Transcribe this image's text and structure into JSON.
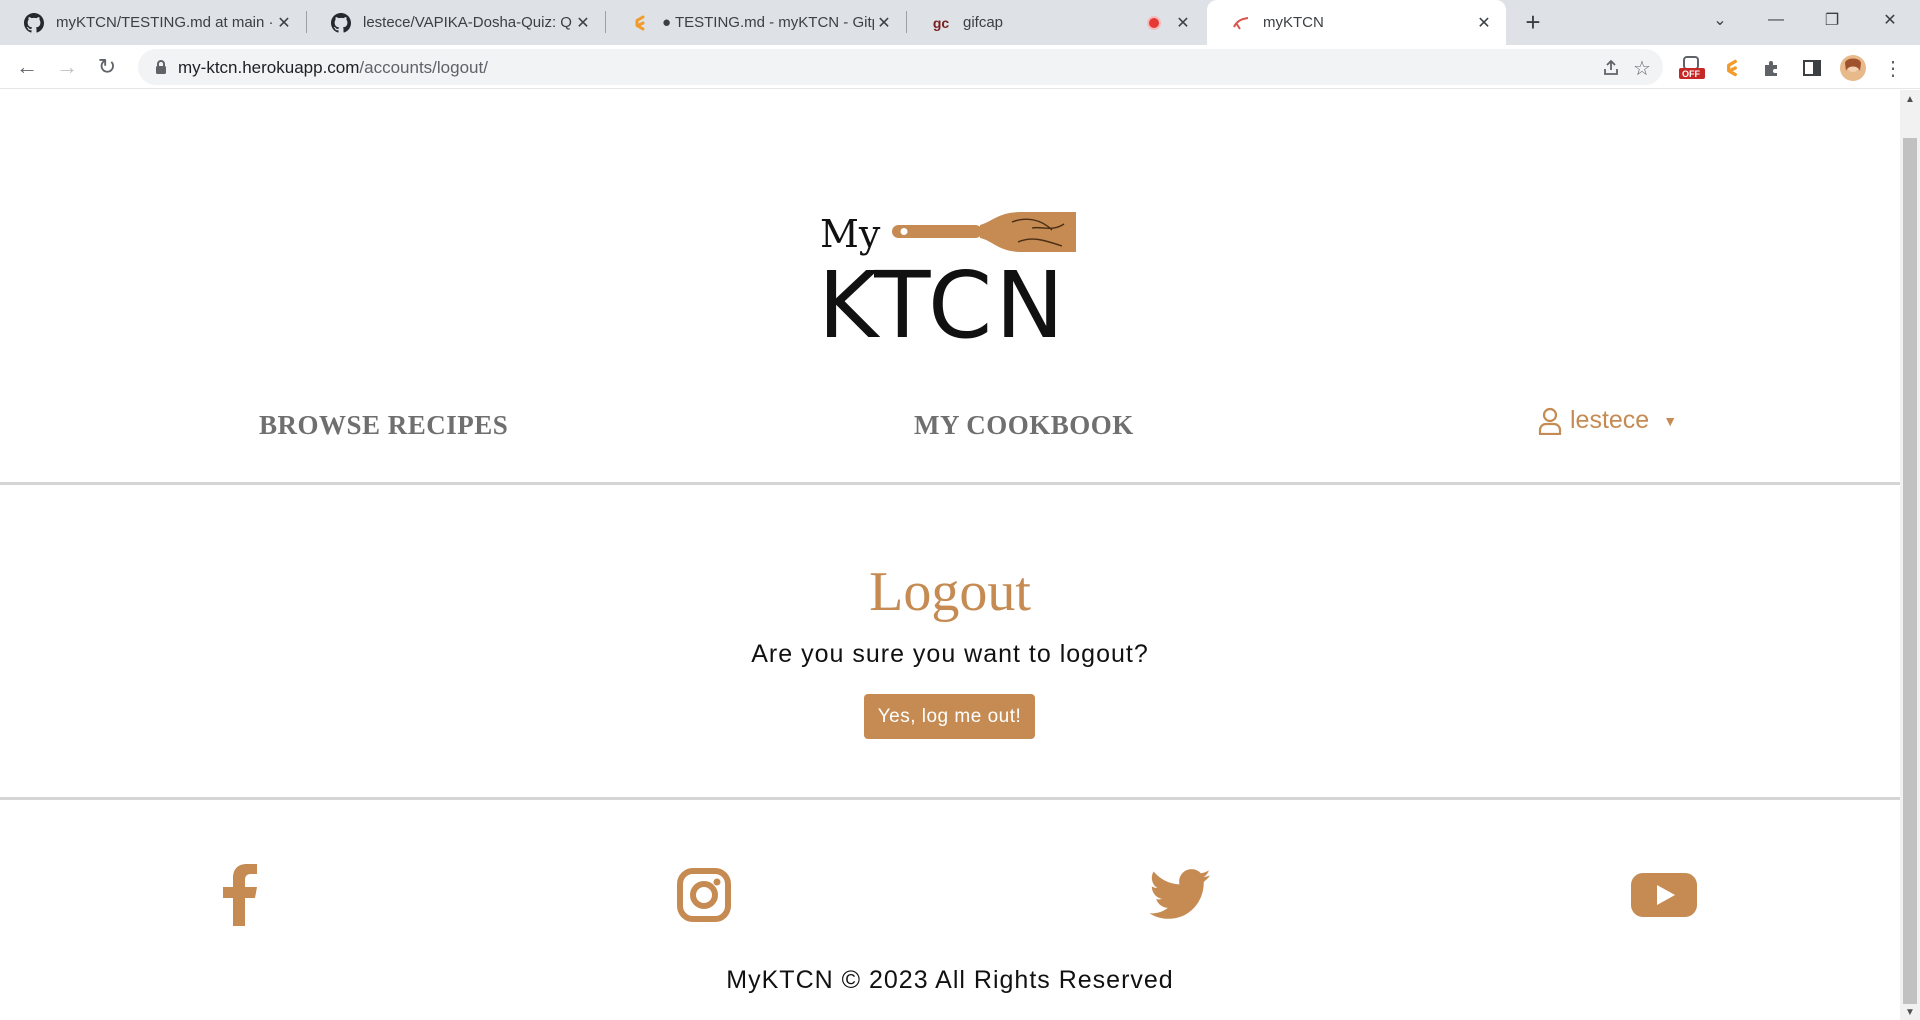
{
  "browser": {
    "tabs": [
      {
        "title": "myKTCN/TESTING.md at main · le",
        "favicon": "github-icon"
      },
      {
        "title": "lestece/VAPIKA-Dosha-Quiz: Quiz",
        "favicon": "github-icon"
      },
      {
        "title": "● TESTING.md - myKTCN - Gitpod",
        "favicon": "gitpod-icon"
      },
      {
        "title": "gifcap",
        "favicon": "gifcap-icon"
      },
      {
        "title": "myKTCN",
        "favicon": "ktcn-icon"
      }
    ],
    "active_tab": 4,
    "address": {
      "host": "my-ktcn.herokuapp.com",
      "path": "/accounts/logout/"
    },
    "extension_badge": "OFF"
  },
  "site": {
    "logo": {
      "top": "My",
      "bottom": "KTCN"
    },
    "nav": {
      "browse": "BROWSE RECIPES",
      "cookbook": "MY COOKBOOK",
      "user": "lestece"
    },
    "logout": {
      "title": "Logout",
      "question": "Are you sure you want to logout?",
      "button": "Yes, log me out!"
    },
    "footer": {
      "social": [
        "facebook-icon",
        "instagram-icon",
        "twitter-icon",
        "youtube-icon"
      ],
      "copyright": "MyKTCN © 2023 All Rights Reserved"
    },
    "colors": {
      "accent": "#c58b53",
      "nav_text": "#6f6f6f",
      "text": "#111111"
    }
  }
}
